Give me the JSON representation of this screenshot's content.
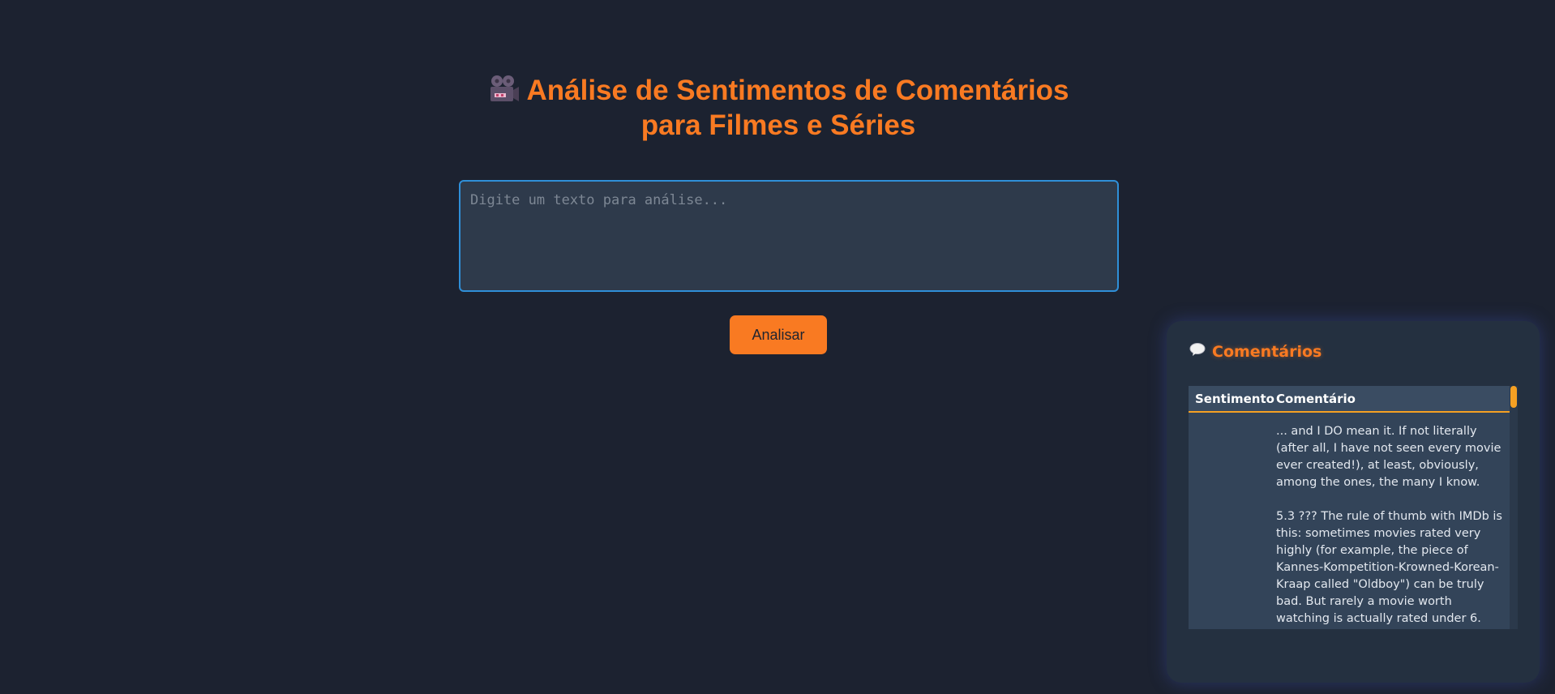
{
  "header": {
    "icon": "movie-camera-icon",
    "title_line1": "Análise de Sentimentos de Comentários",
    "title_line2": "para Filmes e Séries"
  },
  "input": {
    "placeholder": "Digite um texto para análise...",
    "value": ""
  },
  "analyze_button": {
    "label": "Analisar"
  },
  "comments_panel": {
    "icon": "speech-bubble-icon",
    "title": "Comentários",
    "columns": [
      "Sentimento",
      "Comentário"
    ],
    "rows": [
      {
        "sentiment": "",
        "comment": "... and I DO mean it. If not literally (after all, I have not seen every movie ever created!), at least, obviously, among the ones, the many I know.\n\n5.3 ??? The rule of thumb with IMDb is this: sometimes movies rated very highly (for example, the piece of Kannes-Kompetition-Krowned-Korean-Kraap called \"Oldboy\") can be truly bad. But rarely a movie worth watching is actually rated under 6. This movie, very much worth watching, is. A diamond..."
      }
    ]
  },
  "colors": {
    "background": "#1c2230",
    "accent": "#f97a22",
    "input_border": "#2f8fd8",
    "table_header_underline": "#f5a023"
  }
}
